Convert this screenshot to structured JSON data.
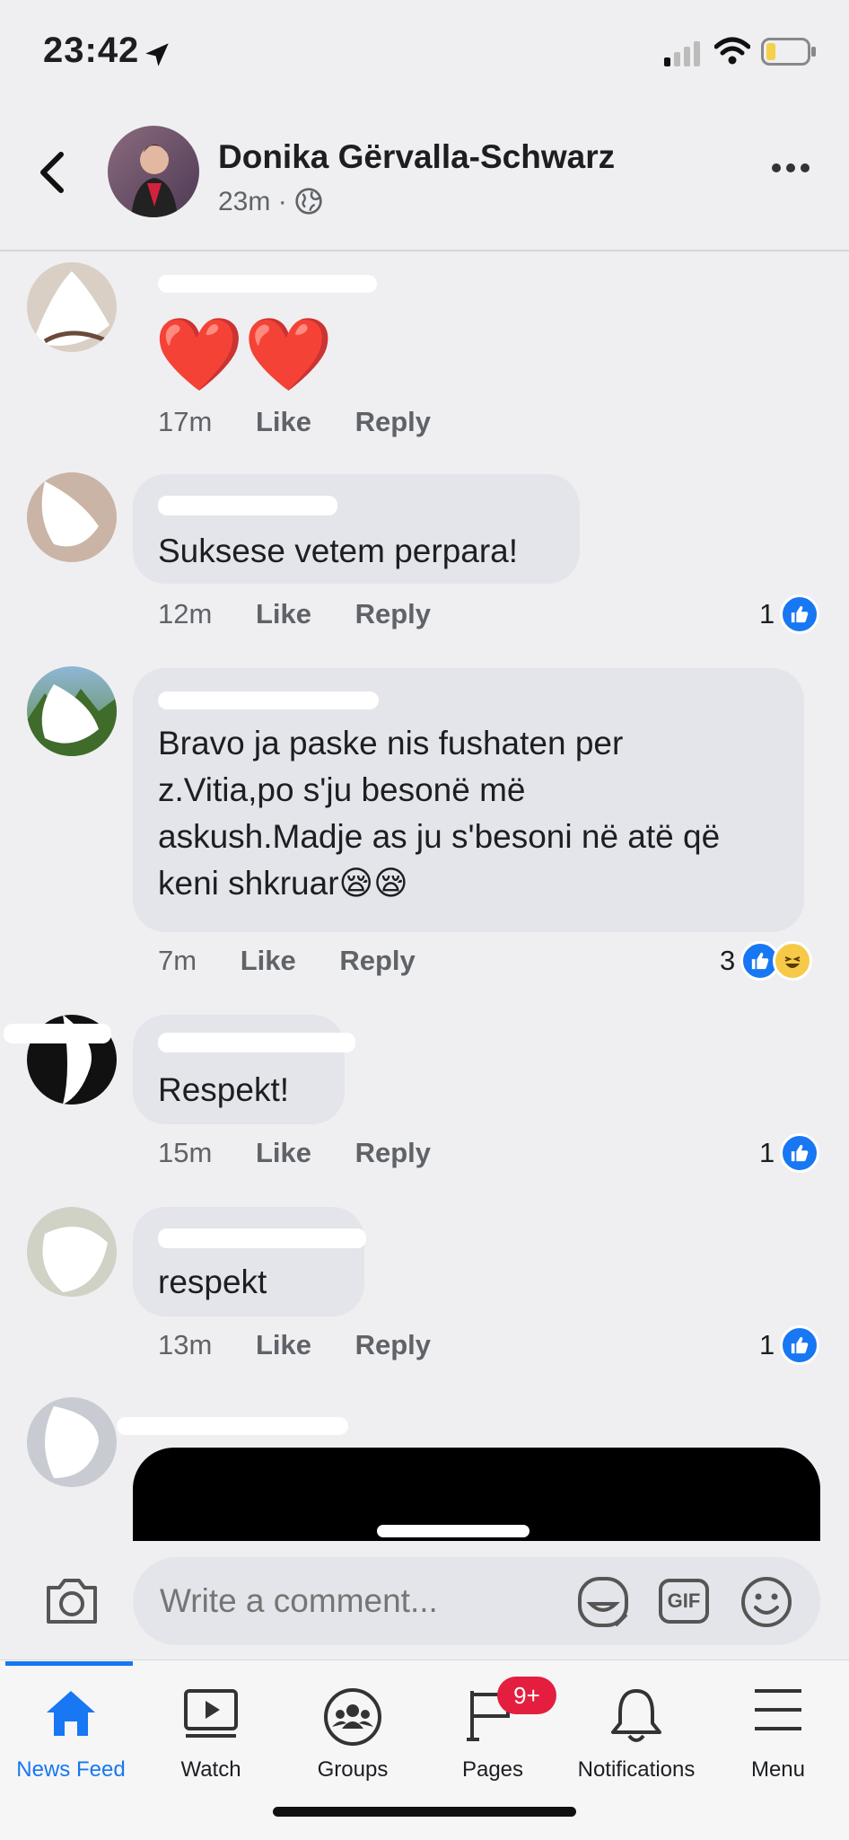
{
  "status_bar": {
    "time": "23:42"
  },
  "post": {
    "author": "Donika Gërvalla-Schwarz",
    "age": "23m",
    "separator": "·"
  },
  "colors": {
    "accent": "#1877f2",
    "badge": "#e41e3f",
    "background": "#efeff1"
  },
  "comments": [
    {
      "author": "",
      "text": "❤️❤️",
      "time": "17m",
      "like": "Like",
      "reply": "Reply",
      "reaction_count": ""
    },
    {
      "author": "",
      "text": "Suksese vetem perpara!",
      "time": "12m",
      "like": "Like",
      "reply": "Reply",
      "reaction_count": "1"
    },
    {
      "author": "",
      "text_lines": [
        "Bravo ja paske nis fushaten per",
        "z.Vitia,po s'ju besonë më",
        "askush.Madje as ju s'besoni në atë që",
        "keni shkruar😪😪"
      ],
      "time": "7m",
      "like": "Like",
      "reply": "Reply",
      "reaction_count": "3"
    },
    {
      "author": "",
      "text": "Respekt!",
      "time": "15m",
      "like": "Like",
      "reply": "Reply",
      "reaction_count": "1"
    },
    {
      "author": "",
      "text": "respekt",
      "time": "13m",
      "like": "Like",
      "reply": "Reply",
      "reaction_count": "1"
    }
  ],
  "composer": {
    "placeholder": "Write a comment...",
    "gif_label": "GIF"
  },
  "tabs": [
    {
      "label": "News Feed",
      "icon": "home-icon",
      "active": true
    },
    {
      "label": "Watch",
      "icon": "watch-icon"
    },
    {
      "label": "Groups",
      "icon": "groups-icon"
    },
    {
      "label": "Pages",
      "icon": "pages-flag-icon",
      "badge": "9+"
    },
    {
      "label": "Notifications",
      "icon": "bell-icon"
    },
    {
      "label": "Menu",
      "icon": "hamburger-icon"
    }
  ]
}
